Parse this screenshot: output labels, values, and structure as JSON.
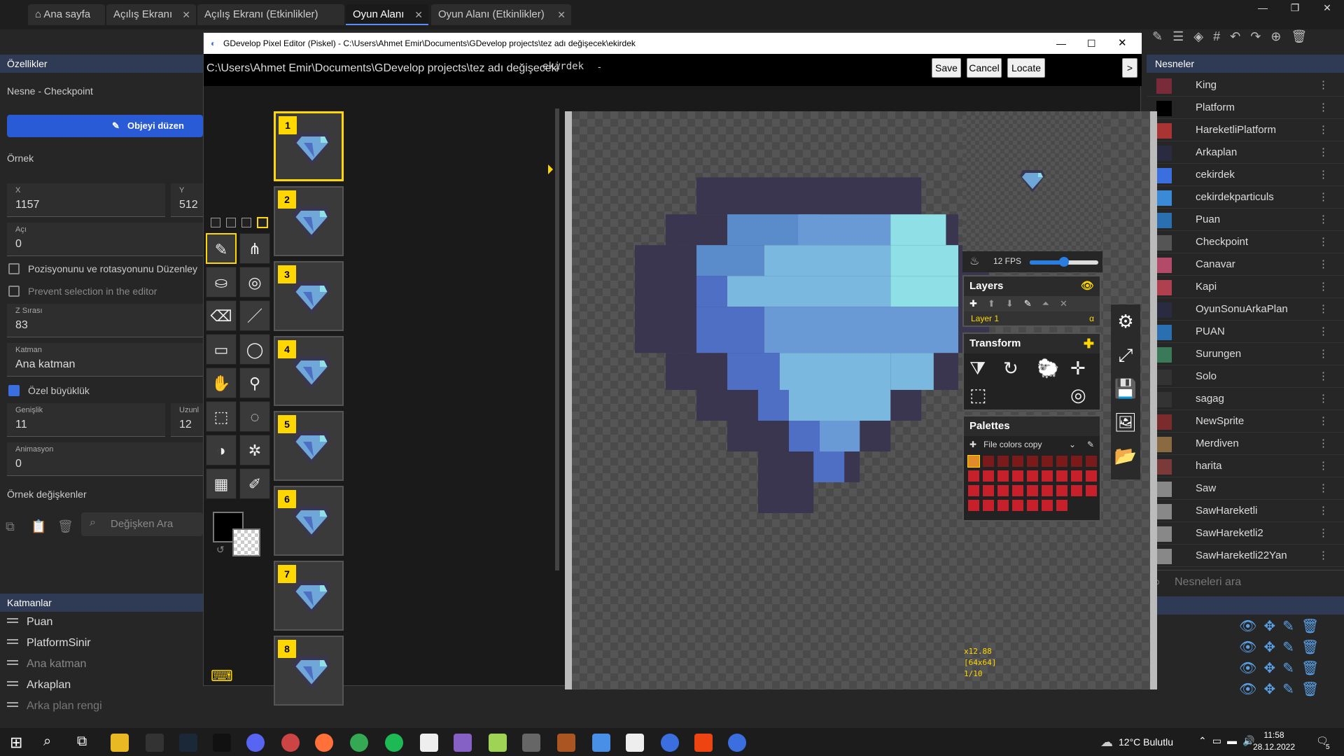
{
  "tabs": [
    {
      "label": "Ana sayfa",
      "icon": "home-icon"
    },
    {
      "label": "Açılış Ekranı"
    },
    {
      "label": "Açılış Ekranı (Etkinlikler)"
    },
    {
      "label": "Oyun Alanı"
    },
    {
      "label": "Oyun Alanı (Etkinlikler)"
    }
  ],
  "properties": {
    "title": "Özellikler",
    "object_line": "Nesne  - Checkpoint",
    "edit_button": "Objeyi düzen",
    "instance_title": "Örnek",
    "x_label": "X",
    "x_value": "1157",
    "y_label": "Y",
    "y_value": "512",
    "angle_label": "Açı",
    "angle_value": "0",
    "lock_label": "Pozisyonunu ve rotasyonunu Düzenley",
    "prevent_label": "Prevent selection in the editor",
    "z_label": "Z Sırası",
    "z_value": "83",
    "layer_label": "Katman",
    "layer_value": "Ana katman",
    "custom_size_label": "Özel büyüklük",
    "width_label": "Genişlik",
    "width_value": "11",
    "height_label": "Uzunl",
    "height_value": "12",
    "anim_label": "Animasyon",
    "anim_value": "0",
    "vars_title": "Örnek değişkenler",
    "var_search": "Değişken Ara"
  },
  "layers": {
    "title": "Katmanlar",
    "items": [
      "Puan",
      "PlatformSinir",
      "Ana katman",
      "Arkaplan",
      "Arka plan rengi"
    ]
  },
  "piskel": {
    "window_title": "GDevelop Pixel Editor (Piskel) - C:\\Users\\Ahmet Emir\\Documents\\GDevelop projects\\tez adı değişecek\\ekirdek",
    "path": "C:\\Users\\Ahmet Emir\\Documents\\GDevelop projects\\tez adı değişecek/",
    "file_name": "ekirdek",
    "file_suffix": "-",
    "save": "Save",
    "cancel": "Cancel",
    "locate": "Locate",
    "more": ">",
    "frames": [
      "1",
      "2",
      "3",
      "4",
      "5",
      "6",
      "7",
      "8"
    ],
    "fps": "12 FPS",
    "fps_level": 0.5,
    "layers_title": "Layers",
    "layer_name": "Layer 1",
    "layer_alpha": "α",
    "transform_title": "Transform",
    "palettes_title": "Palettes",
    "palette_name": "File colors copy",
    "zoom": "x12.88",
    "size": "[64x64]",
    "frame_index": "1/10"
  },
  "objects": {
    "title": "Nesneler",
    "search": "Nesneleri ara",
    "items": [
      "King",
      "Platform",
      "HareketliPlatform",
      "Arkaplan",
      "cekirdek",
      "cekirdekparticuls",
      "Puan",
      "Checkpoint",
      "Canavar",
      "Kapi",
      "OyunSonuArkaPlan",
      "PUAN",
      "Surungen",
      "Solo",
      "sagag",
      "NewSprite",
      "Merdiven",
      "harita",
      "Saw",
      "SawHareketli",
      "SawHareketli2",
      "SawHareketli22Yan"
    ]
  },
  "taskbar": {
    "weather": "12°C  Bulutlu",
    "time": "11:58",
    "date": "28.12.2022",
    "notif": "5"
  },
  "colors": {
    "accent": "#ffd700",
    "pixel_dark": "#3b3650",
    "pixel_blue": "#4e6fc4",
    "pixel_light": "#8ee0e6"
  }
}
